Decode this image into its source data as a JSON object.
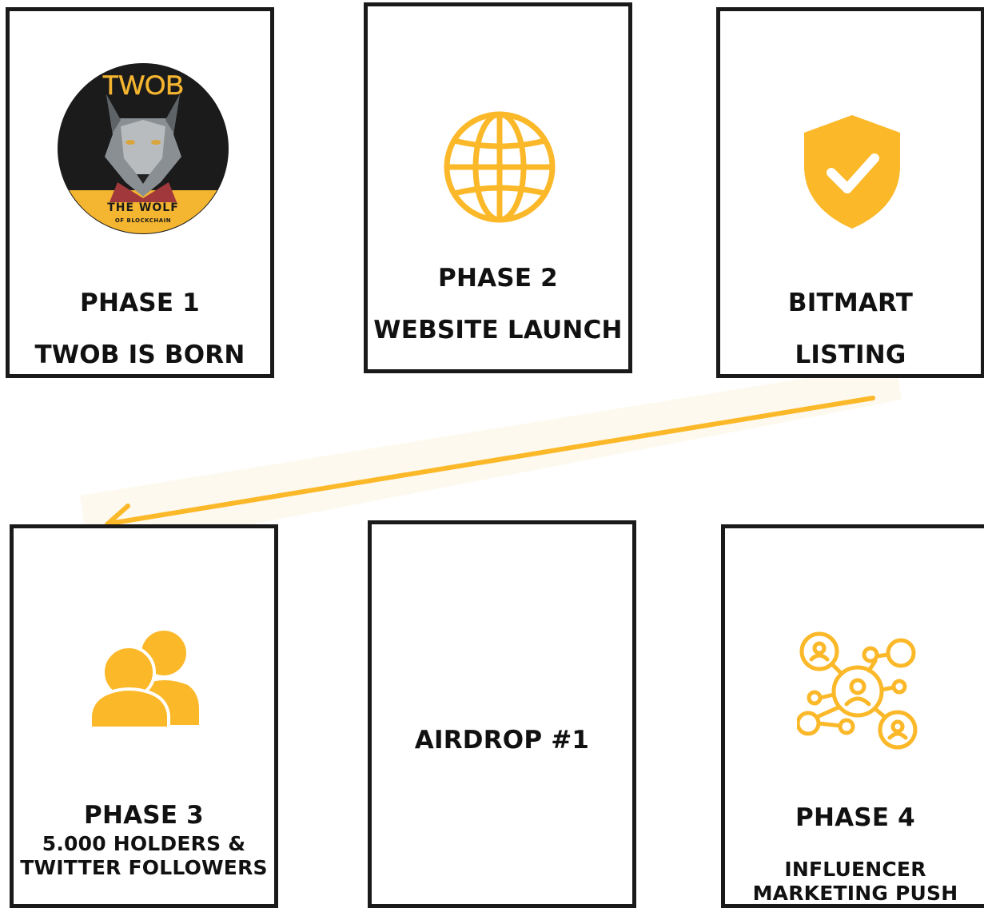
{
  "accent_color": "#FBB829",
  "logo": {
    "brand": "TWOB",
    "tagline": "THE WOLF",
    "sub": "OF BLOCKCHAIN"
  },
  "cards": {
    "phase1": {
      "icon": "twob-wolf-logo",
      "title": "PHASE 1",
      "subtitle": "TWOB IS BORN"
    },
    "phase2": {
      "icon": "globe-icon",
      "title": "PHASE 2",
      "subtitle": "WEBSITE LAUNCH"
    },
    "bitmart": {
      "icon": "shield-check-icon",
      "title": "BITMART",
      "subtitle": "LISTING"
    },
    "phase3": {
      "icon": "users-icon",
      "title": "PHASE 3",
      "line2": "5.000 HOLDERS &",
      "line3": "TWITTER FOLLOWERS"
    },
    "airdrop": {
      "title": "AIRDROP #1"
    },
    "phase4": {
      "icon": "network-people-icon",
      "title": "PHASE 4",
      "line2": "INFLUENCER",
      "line3": "MARKETING PUSH"
    }
  }
}
